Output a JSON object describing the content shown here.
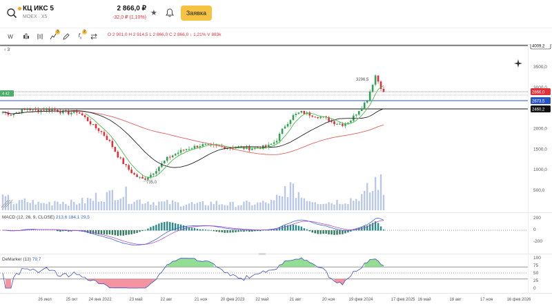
{
  "header": {
    "ticker": "КЦ ИКС 5",
    "exchange": "MOEX · X5",
    "price": "2 866,0 ₽",
    "change": "-32,0 ₽ (1,10%)",
    "order_button": "Заявка"
  },
  "toolbar": {
    "interval": "W",
    "indicator_badge": "3",
    "fx_badge": "2",
    "ohlc_text": "O 2 901,0  H 2 914,5  L 2 866,0  C 2 866,0  ↓ 1,21%  V 883k"
  },
  "collapse": "‹ 3",
  "price_axis": [
    "3500,0",
    "3000,0",
    "2500,0",
    "2000,0",
    "1500,0",
    "1000,0",
    "500,0"
  ],
  "price_badges": {
    "top": "4009,2",
    "current": "2866,0",
    "level_blue": "2673,5",
    "level_black": "2460,2",
    "left": "4 42"
  },
  "annotations": {
    "high": "3296,5",
    "low": "735,0"
  },
  "macd": {
    "name": "MACD (12, 26, 9, CLOSE)",
    "v1": "213,6",
    "v2": "184,1",
    "v3": "29,5",
    "axis": [
      "200",
      "0",
      "-200"
    ]
  },
  "demarker": {
    "name": "DeMarker (13)",
    "value": "79,7",
    "axis": [
      "100",
      "75",
      "50",
      "25",
      "0"
    ]
  },
  "x_axis": [
    "26 июл",
    "25 окт",
    "24 янв 2022",
    "23 май",
    "22 авг",
    "21 ноя",
    "20 фев 2023",
    "22 май",
    "21 авг",
    "20 ноя",
    "19 фев 2024",
    "17 фев 2025",
    "16 май",
    "18 авг",
    "17 ноя",
    "16 фев 2026"
  ],
  "colors": {
    "up": "#2fa34f",
    "down": "#e0303a",
    "accent": "#f5c242",
    "ma_fast": "#4cba4c",
    "ma_mid": "#222222",
    "ma_slow": "#e06060",
    "badge_blue": "#2554c7"
  },
  "chart_data": {
    "type": "candlestick",
    "close_series": [
      2400,
      2350,
      2420,
      2480,
      2440,
      2460,
      2470,
      2410,
      2380,
      2420,
      2250,
      2050,
      1900,
      1650,
      1300,
      1050,
      850,
      760,
      900,
      1100,
      1300,
      1400,
      1500,
      1550,
      1600,
      1580,
      1560,
      1550,
      1540,
      1530,
      1520,
      1540,
      1560,
      1700,
      2050,
      2300,
      2400,
      2350,
      2300,
      2250,
      2150,
      2100,
      2200,
      2450,
      2700,
      3296,
      2866
    ],
    "volume": [
      1.5,
      1.0,
      1.2,
      1.1,
      0.9,
      1.0,
      1.3,
      1.1,
      1.0,
      1.2,
      1.4,
      1.8,
      2.0,
      2.4,
      2.2,
      1.5,
      1.3,
      1.2,
      1.1,
      1.0,
      1.0,
      0.9,
      0.9,
      0.8,
      0.9,
      1.0,
      0.9,
      0.8,
      0.8,
      0.9,
      0.9,
      1.0,
      1.1,
      1.6,
      3.0,
      2.5,
      1.8,
      1.4,
      1.2,
      1.1,
      1.2,
      1.3,
      1.5,
      2.0,
      2.6,
      4.0,
      2.0
    ],
    "ylim": [
      500,
      3600
    ]
  }
}
